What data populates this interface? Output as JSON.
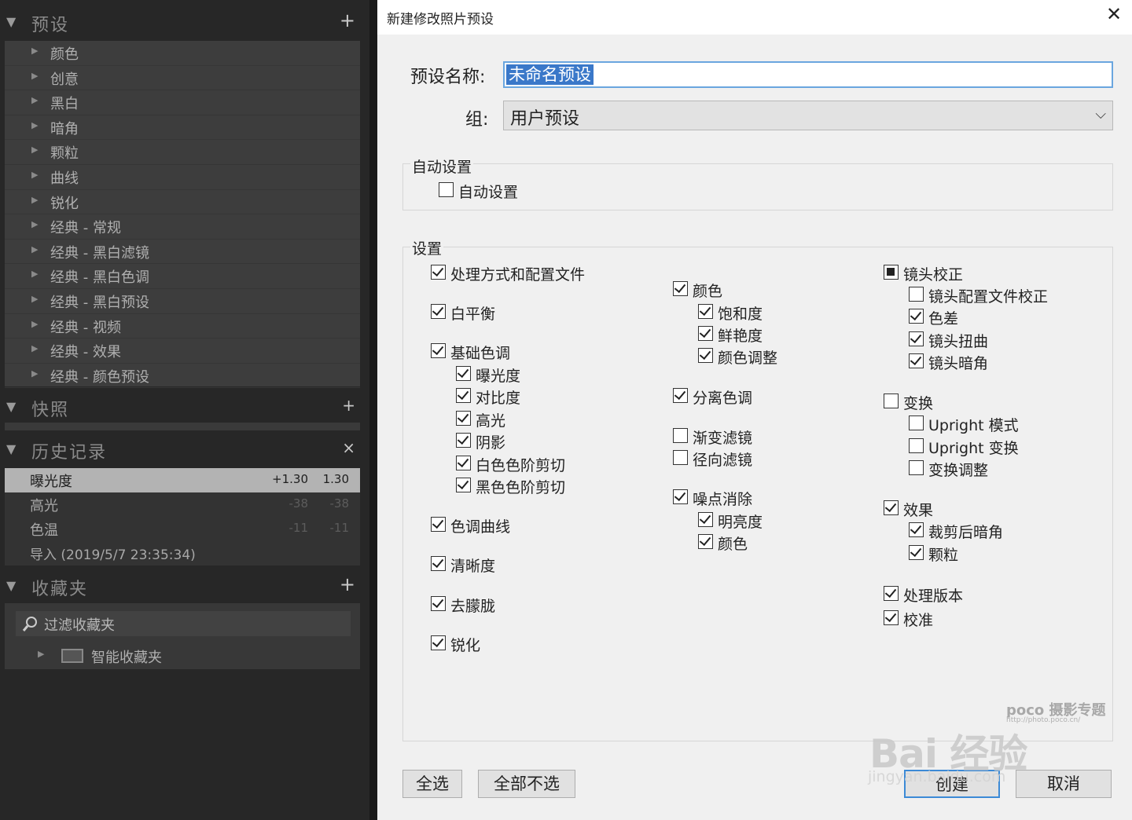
{
  "left_panel": {
    "presets": {
      "title": "预设",
      "add_label": "+",
      "items": [
        "颜色",
        "创意",
        "黑白",
        "暗角",
        "颗粒",
        "曲线",
        "锐化",
        "经典 - 常规",
        "经典 - 黑白滤镜",
        "经典 - 黑白色调",
        "经典 - 黑白预设",
        "经典 - 视频",
        "经典 - 效果",
        "经典 - 颜色预设"
      ]
    },
    "snapshots": {
      "title": "快照",
      "add_label": "+"
    },
    "history": {
      "title": "历史记录",
      "clear_label": "×",
      "rows": [
        {
          "label": "曝光度",
          "v1": "+1.30",
          "v2": "1.30"
        },
        {
          "label": "高光",
          "v1": "-38",
          "v2": "-38"
        },
        {
          "label": "色温",
          "v1": "-11",
          "v2": "-11"
        },
        {
          "label": "导入 (2019/5/7 23:35:34)",
          "v1": "",
          "v2": ""
        }
      ]
    },
    "collections": {
      "title": "收藏夹",
      "add_label": "+",
      "filter_label": "过滤收藏夹",
      "smart_label": "智能收藏夹"
    }
  },
  "dialog": {
    "title": "新建修改照片预设",
    "close_label": "✕",
    "name_label": "预设名称:",
    "name_value": "未命名预设",
    "group_label": "组:",
    "group_value": "用户预设",
    "auto_group_title": "自动设置",
    "auto_checkbox": "自动设置",
    "settings_title": "设置",
    "col1": [
      {
        "label": "处理方式和配置文件",
        "state": "checked"
      },
      {
        "label": "白平衡",
        "state": "checked"
      },
      {
        "label": "基础色调",
        "state": "checked"
      },
      {
        "label": "曝光度",
        "state": "checked"
      },
      {
        "label": "对比度",
        "state": "checked"
      },
      {
        "label": "高光",
        "state": "checked"
      },
      {
        "label": "阴影",
        "state": "checked"
      },
      {
        "label": "白色色阶剪切",
        "state": "checked"
      },
      {
        "label": "黑色色阶剪切",
        "state": "checked"
      },
      {
        "label": "色调曲线",
        "state": "checked"
      },
      {
        "label": "清晰度",
        "state": "checked"
      },
      {
        "label": "去朦胧",
        "state": "checked"
      },
      {
        "label": "锐化",
        "state": "checked"
      }
    ],
    "col2": [
      {
        "label": "颜色",
        "state": "checked"
      },
      {
        "label": "饱和度",
        "state": "checked"
      },
      {
        "label": "鲜艳度",
        "state": "checked"
      },
      {
        "label": "颜色调整",
        "state": "checked"
      },
      {
        "label": "分离色调",
        "state": "checked"
      },
      {
        "label": "渐变滤镜",
        "state": "unchecked"
      },
      {
        "label": "径向滤镜",
        "state": "unchecked"
      },
      {
        "label": "噪点消除",
        "state": "checked"
      },
      {
        "label": "明亮度",
        "state": "checked"
      },
      {
        "label": "颜色",
        "state": "checked"
      }
    ],
    "col3": [
      {
        "label": "镜头校正",
        "state": "partial"
      },
      {
        "label": "镜头配置文件校正",
        "state": "unchecked"
      },
      {
        "label": "色差",
        "state": "checked"
      },
      {
        "label": "镜头扭曲",
        "state": "checked"
      },
      {
        "label": "镜头暗角",
        "state": "checked"
      },
      {
        "label": "变换",
        "state": "unchecked"
      },
      {
        "label": "Upright 模式",
        "state": "unchecked"
      },
      {
        "label": "Upright 变换",
        "state": "unchecked"
      },
      {
        "label": "变换调整",
        "state": "unchecked"
      },
      {
        "label": "效果",
        "state": "checked"
      },
      {
        "label": "裁剪后暗角",
        "state": "checked"
      },
      {
        "label": "颗粒",
        "state": "checked"
      },
      {
        "label": "处理版本",
        "state": "checked"
      },
      {
        "label": "校准",
        "state": "checked"
      }
    ],
    "buttons": {
      "select_all": "全选",
      "select_none": "全部不选",
      "create": "创建",
      "cancel": "取消"
    }
  },
  "watermark": {
    "poco": "poco 摄影专题",
    "poco_url": "http://photo.poco.cn/",
    "baidu": "Bai 经验",
    "url": "jingyan.baidu.com"
  }
}
